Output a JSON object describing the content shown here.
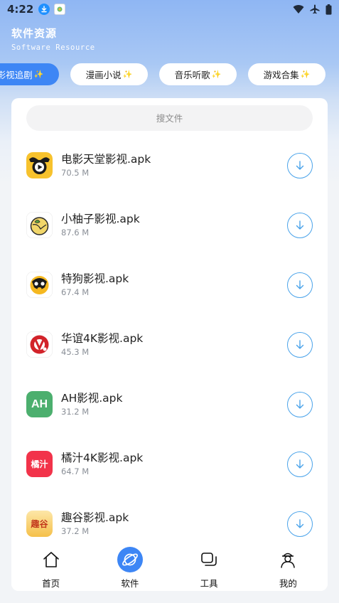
{
  "status_bar": {
    "time": "4:22"
  },
  "header": {
    "title": "软件资源",
    "subtitle": "Software Resource"
  },
  "tabs": [
    {
      "label": "影视追剧",
      "active": true
    },
    {
      "label": "漫画小说",
      "active": false
    },
    {
      "label": "音乐听歌",
      "active": false
    },
    {
      "label": "游戏合集",
      "active": false
    }
  ],
  "search": {
    "placeholder": "搜文件"
  },
  "files": [
    {
      "name": "电影天堂影视.apk",
      "size": "70.5 M",
      "icon": "movie-heaven-icon"
    },
    {
      "name": "小柚子影视.apk",
      "size": "87.6 M",
      "icon": "pomelo-icon"
    },
    {
      "name": "特狗影视.apk",
      "size": "67.4 M",
      "icon": "dog-icon"
    },
    {
      "name": "华谊4K影视.apk",
      "size": "45.3 M",
      "icon": "huayi-icon"
    },
    {
      "name": "AH影视.apk",
      "size": "31.2 M",
      "icon": "ah-icon",
      "icon_text": "AH"
    },
    {
      "name": "橘汁4K影视.apk",
      "size": "64.7 M",
      "icon": "juzhi-icon",
      "icon_text": "橘汁"
    },
    {
      "name": "趣谷影视.apk",
      "size": "37.2 M",
      "icon": "qugu-icon",
      "icon_text": "趣谷"
    }
  ],
  "bottom_nav": [
    {
      "label": "首页",
      "icon": "home-icon",
      "active": false
    },
    {
      "label": "软件",
      "icon": "planet-icon",
      "active": true
    },
    {
      "label": "工具",
      "icon": "tools-icon",
      "active": false
    },
    {
      "label": "我的",
      "icon": "profile-icon",
      "active": false
    }
  ],
  "colors": {
    "accent": "#3d86f5",
    "download_ring": "#4aa3ea",
    "ah_green": "#4caf6e",
    "juzhi_red": "#f2334a"
  }
}
